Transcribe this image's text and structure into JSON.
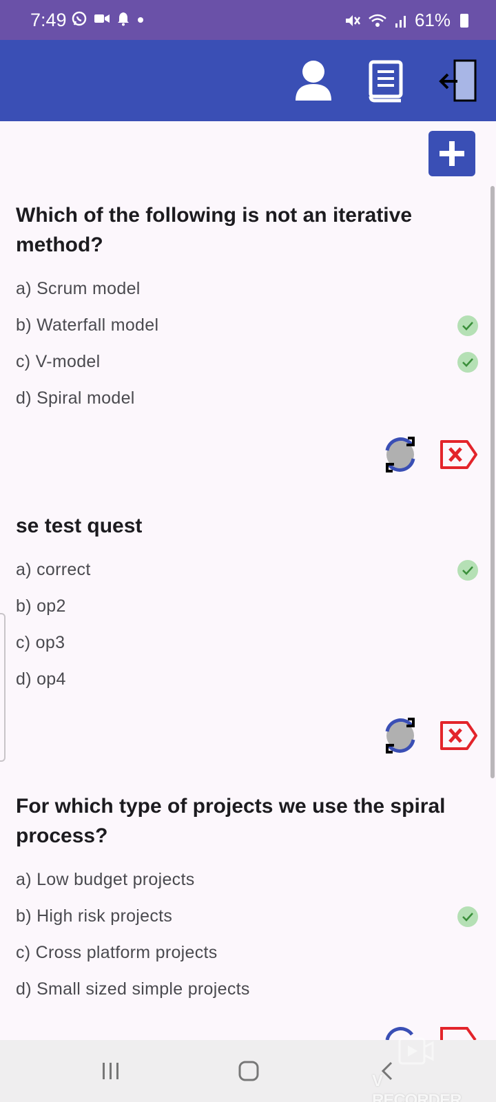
{
  "status_bar": {
    "time": "7:49",
    "battery": "61%",
    "left_icons": [
      "whatsapp-icon",
      "video-icon",
      "bell-icon",
      "dot-icon"
    ],
    "right_icons": [
      "mute-icon",
      "wifi-icon",
      "signal-icon",
      "battery-icon"
    ]
  },
  "app_bar": {
    "icons": [
      "profile-icon",
      "book-icon",
      "logout-icon"
    ],
    "color": "#3a4fb5"
  },
  "add_button": {
    "icon": "plus-icon"
  },
  "questions": [
    {
      "text": "Which of the following is not an iterative method?",
      "options": [
        {
          "label": "a) Scrum model",
          "correct": false
        },
        {
          "label": "b) Waterfall model",
          "correct": true
        },
        {
          "label": "c) V-model",
          "correct": true
        },
        {
          "label": "d) Spiral model",
          "correct": false
        }
      ],
      "actions": [
        "refresh-icon",
        "delete-icon"
      ]
    },
    {
      "text": "se test quest",
      "options": [
        {
          "label": "a) correct",
          "correct": true
        },
        {
          "label": "b) op2",
          "correct": false
        },
        {
          "label": "c) op3",
          "correct": false
        },
        {
          "label": "d) op4",
          "correct": false
        }
      ],
      "actions": [
        "refresh-icon",
        "delete-icon"
      ]
    },
    {
      "text": "For which type of projects we use the spiral process?",
      "options": [
        {
          "label": "a) Low budget projects",
          "correct": false
        },
        {
          "label": "b) High risk projects",
          "correct": true
        },
        {
          "label": "c) Cross platform projects",
          "correct": false
        },
        {
          "label": "d) Small sized simple projects",
          "correct": false
        }
      ],
      "actions": [
        "refresh-icon",
        "delete-icon"
      ]
    }
  ],
  "nav_bar": {
    "icons": [
      "recents-icon",
      "home-icon",
      "back-icon"
    ]
  },
  "watermark": {
    "text": "V RECORDER"
  },
  "colors": {
    "accent": "#3a4fb5",
    "status_bar": "#6a51a8",
    "correct": "#b5e0b5",
    "delete": "#e3242b"
  }
}
